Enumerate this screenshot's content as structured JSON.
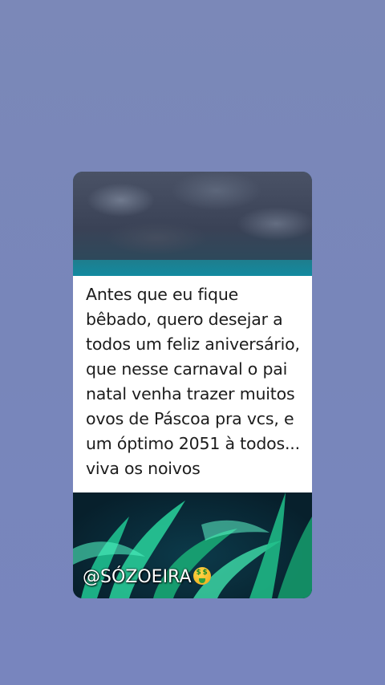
{
  "post": {
    "text": "Antes que eu fique bêbado, quero desejar a todos um feliz aniversário, que nesse carnaval o pai natal venha trazer muitos ovos de Páscoa pra vcs, e um óptimo 2051 à todos... viva os noivos",
    "handle": "@SÓZOEIRA",
    "handle_emoji": "money-mouth-face-icon"
  },
  "colors": {
    "page_background": "#7b88b8",
    "text_box_background": "#ffffff",
    "text_color": "#1c1c1c"
  }
}
